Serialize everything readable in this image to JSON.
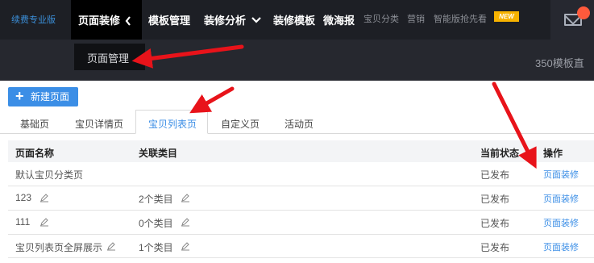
{
  "nav": {
    "brand": "续费专业版",
    "active_item": "页面装修",
    "items": [
      "模板管理",
      "装修分析"
    ],
    "item_template": "装修模板",
    "item_poster": "微海报",
    "small_items": [
      "宝贝分类",
      "营销",
      "智能版抢先看"
    ],
    "new_badge": "NEW"
  },
  "dropdown": {
    "label": "页面管理"
  },
  "side_note": "350模板直",
  "content": {
    "new_button": "新建页面",
    "tabs": [
      "基础页",
      "宝贝详情页",
      "宝贝列表页",
      "自定义页",
      "活动页"
    ],
    "active_tab": "宝贝列表页",
    "table": {
      "headers": {
        "name": "页面名称",
        "category": "关联类目",
        "status": "当前状态",
        "action": "操作"
      },
      "rows": [
        {
          "name": "默认宝贝分类页",
          "category": "",
          "status": "已发布",
          "action": "页面装修"
        },
        {
          "name": "123",
          "category": "2个类目",
          "status": "已发布",
          "action": "页面装修"
        },
        {
          "name": "111",
          "category": "0个类目",
          "status": "已发布",
          "action": "页面装修"
        },
        {
          "name": "宝贝列表页全屏展示",
          "category": "1个类目",
          "status": "已发布",
          "action": "页面装修"
        }
      ]
    }
  },
  "colors": {
    "accent": "#3b8ee6",
    "topbar": "#1d1f25",
    "annotation_arrow": "#e8131a"
  },
  "icons": [
    "chevron-left-icon",
    "chevron-down-icon",
    "mail-icon",
    "plus-icon",
    "edit-pencil-icon"
  ]
}
